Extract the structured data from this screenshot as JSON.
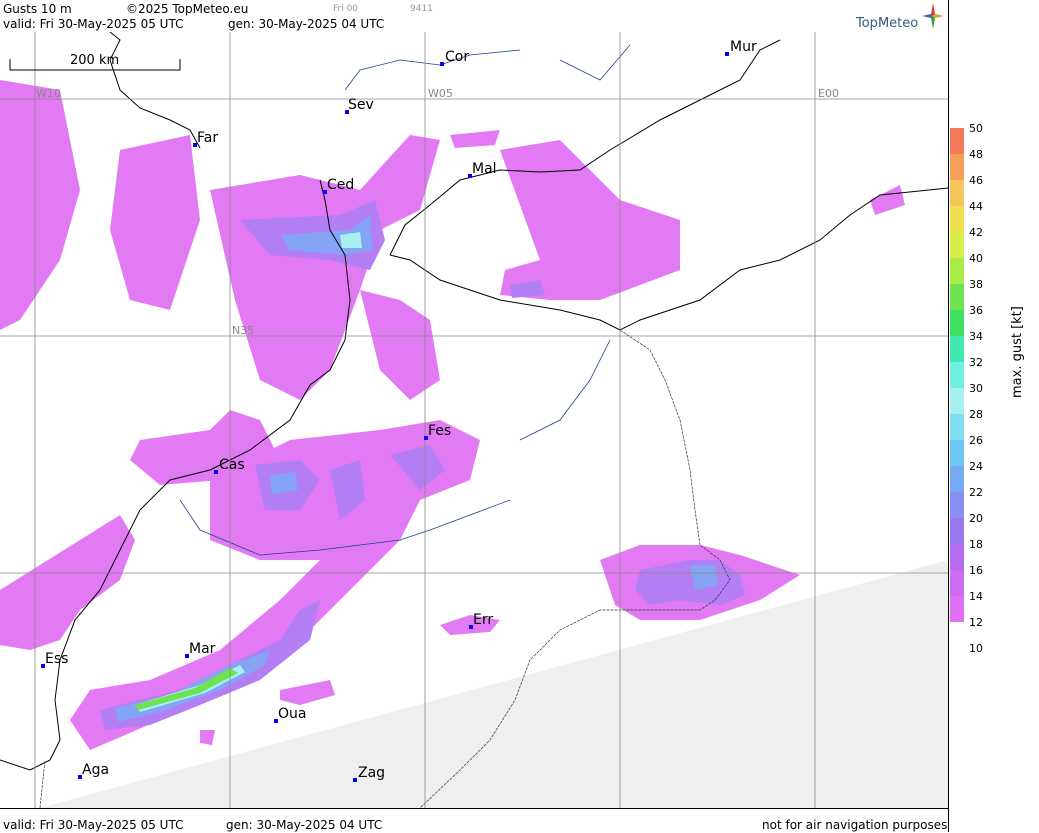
{
  "header": {
    "title": "Gusts 10 m",
    "copyright": "©2025 TopMeteo.eu",
    "step_label": "Fri 00",
    "code": "9411",
    "valid": "valid:  Fri  30-May-2025  05 UTC",
    "generated": "gen: 30-May-2025 04 UTC",
    "brand": "TopMeteo"
  },
  "footer": {
    "valid": "valid:  Fri  30-May-2025  05 UTC",
    "generated": "gen: 30-May-2025 04 UTC",
    "disclaimer": "not for air navigation purposes"
  },
  "map": {
    "scale_bar_label": "200 km",
    "grid_labels": [
      "W10",
      "W05",
      "E00",
      "N35"
    ],
    "cities": [
      "Cor",
      "Mur",
      "Sev",
      "Far",
      "Ced",
      "Mal",
      "Fes",
      "Cas",
      "Err",
      "Mar",
      "Ess",
      "Oua",
      "Aga",
      "Zag"
    ]
  },
  "colorbar": {
    "title": "max. gust [kt]",
    "ticks": [
      "50",
      "48",
      "46",
      "44",
      "42",
      "40",
      "38",
      "36",
      "34",
      "32",
      "30",
      "28",
      "26",
      "24",
      "22",
      "20",
      "18",
      "16",
      "14",
      "12",
      "10"
    ],
    "colors": [
      "#f07a5a",
      "#f2a05a",
      "#f5c45a",
      "#f0e050",
      "#d8ee48",
      "#a8ec48",
      "#6ee250",
      "#3ee060",
      "#40e8b0",
      "#70eee0",
      "#a6f0f2",
      "#80dcf0",
      "#6ec6f4",
      "#78aaf4",
      "#8890f2",
      "#9a78f0",
      "#b46cf0",
      "#cc6cf0",
      "#e070f2"
    ]
  }
}
